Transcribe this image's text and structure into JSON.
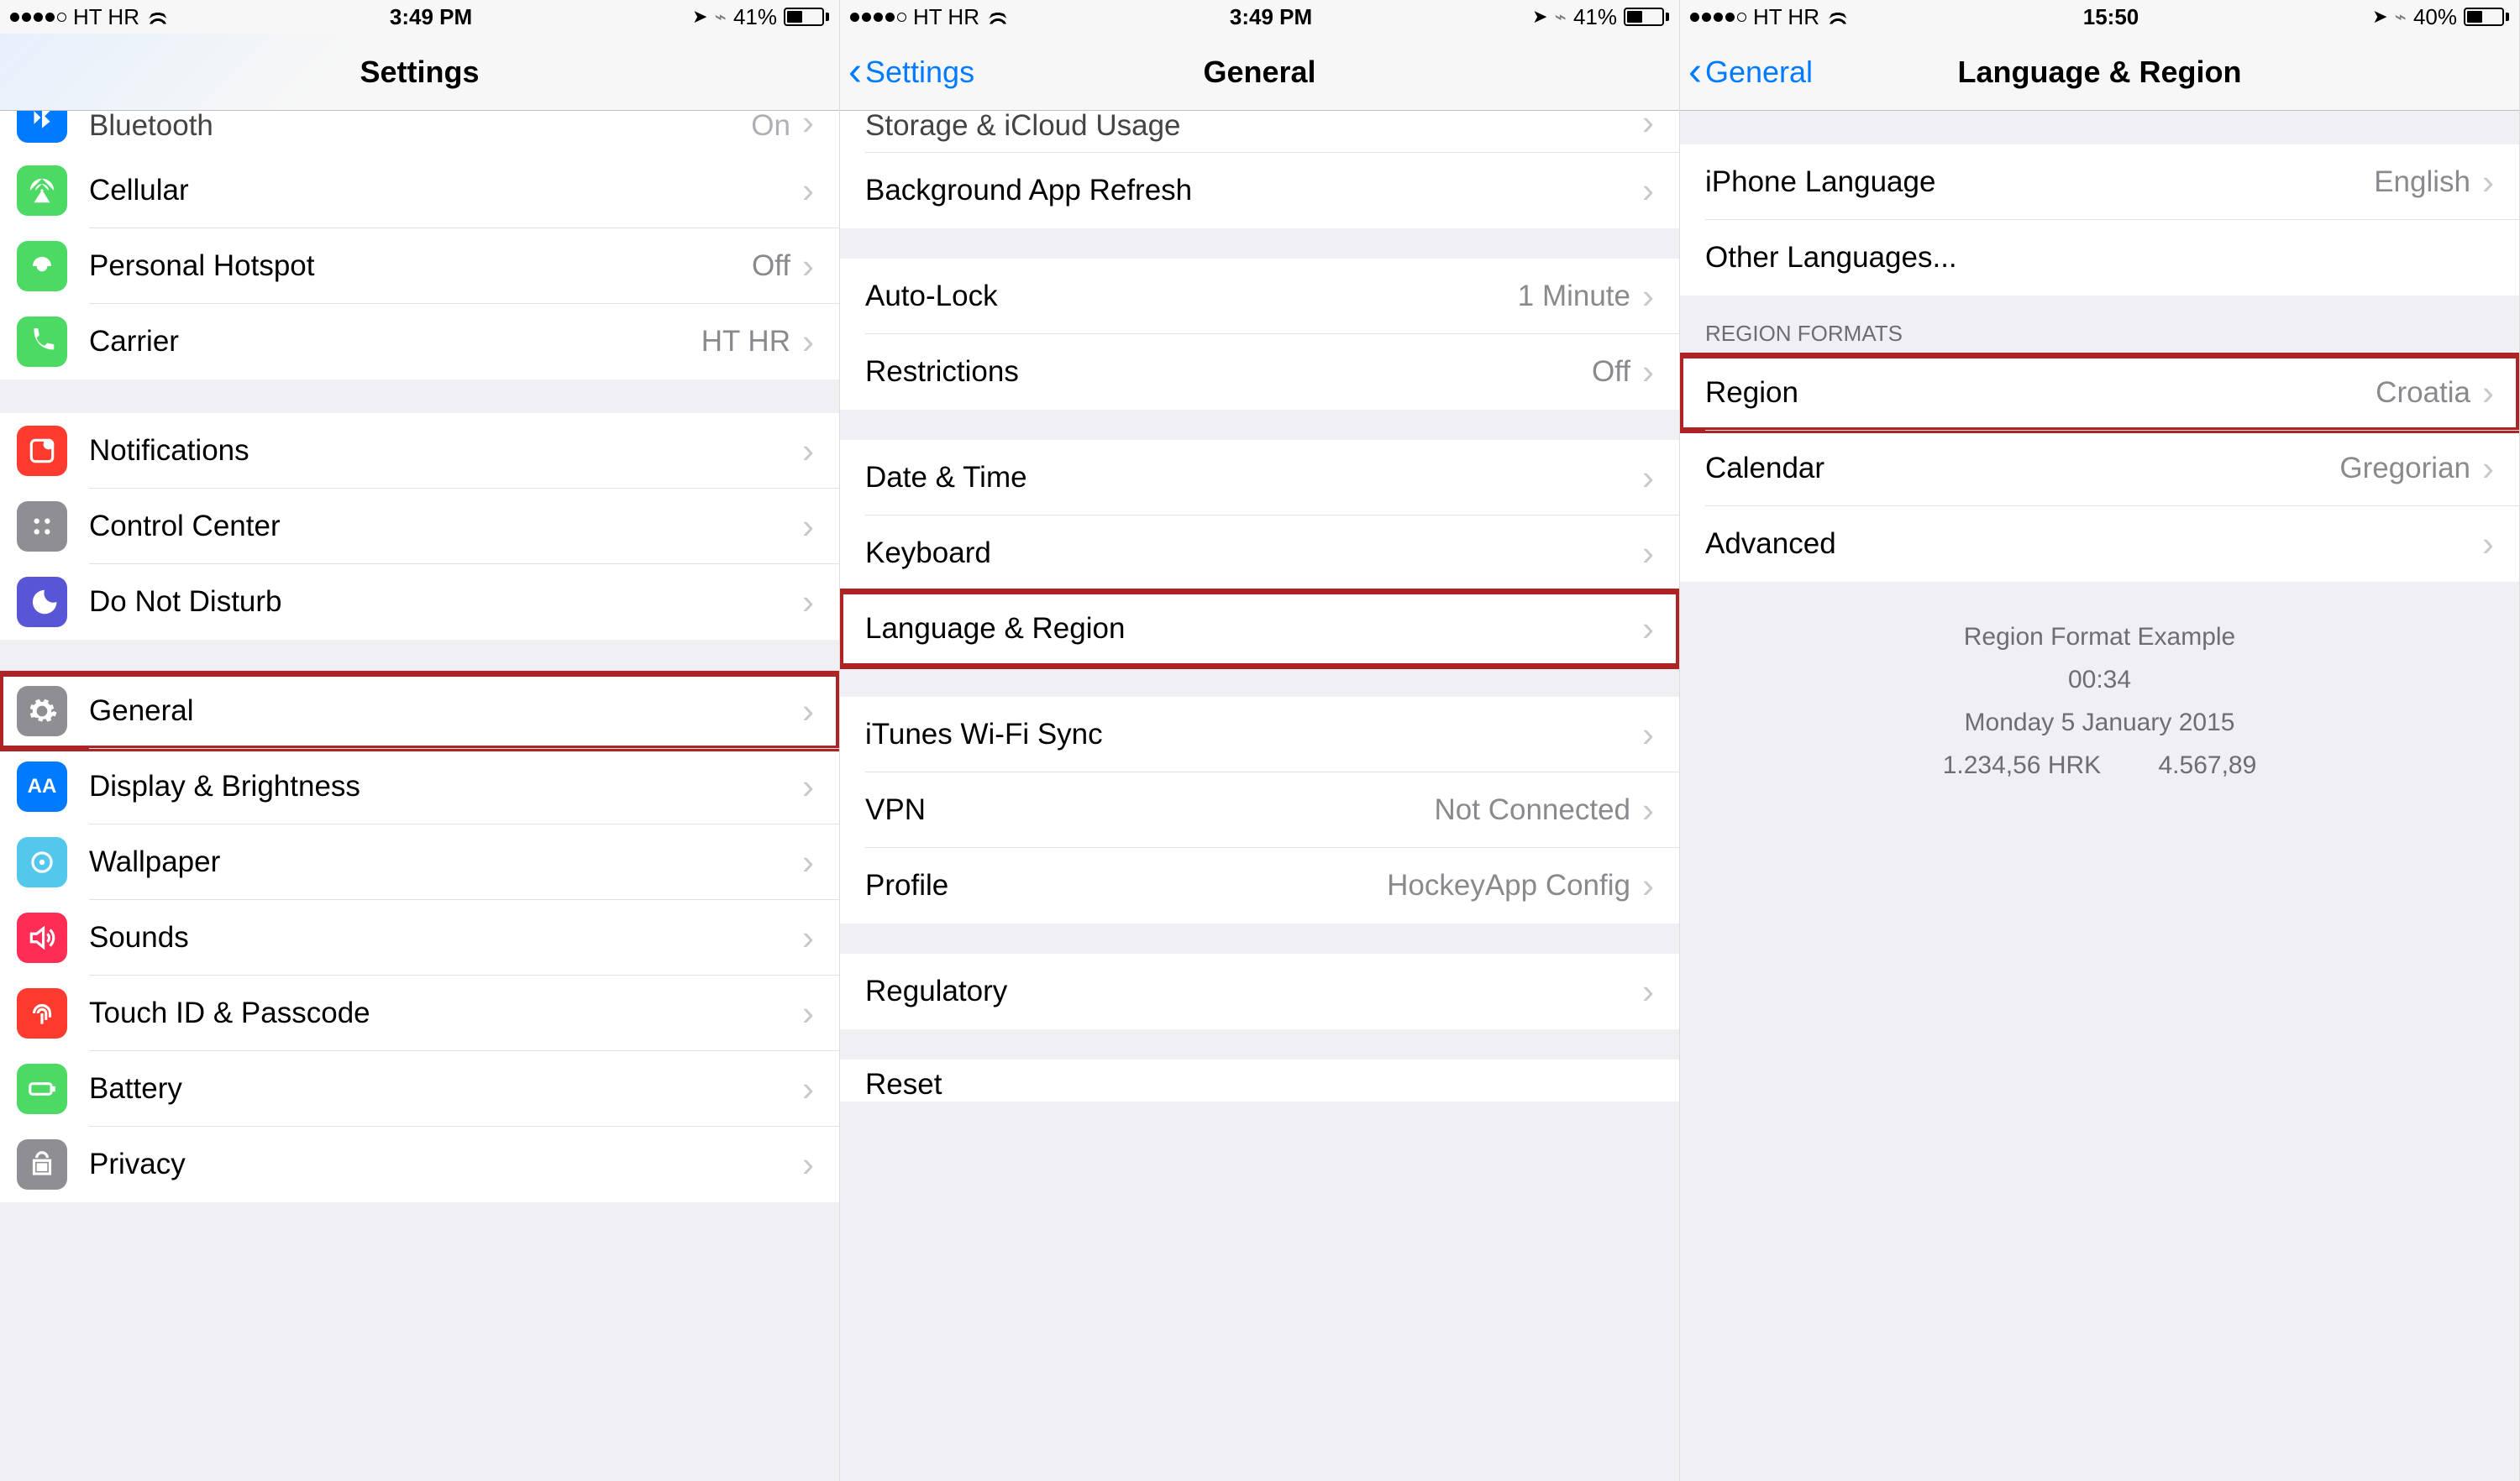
{
  "status": {
    "carrier": "HT HR",
    "time_12h": "3:49 PM",
    "time_24h": "15:50",
    "battery_a": "41%",
    "battery_c": "40%"
  },
  "pane1": {
    "title": "Settings",
    "rows": {
      "bluetooth": {
        "label": "Bluetooth",
        "value": "On"
      },
      "cellular": {
        "label": "Cellular"
      },
      "hotspot": {
        "label": "Personal Hotspot",
        "value": "Off"
      },
      "carrier": {
        "label": "Carrier",
        "value": "HT HR"
      },
      "notifications": {
        "label": "Notifications"
      },
      "control_center": {
        "label": "Control Center"
      },
      "dnd": {
        "label": "Do Not Disturb"
      },
      "general": {
        "label": "General"
      },
      "display": {
        "label": "Display & Brightness"
      },
      "wallpaper": {
        "label": "Wallpaper"
      },
      "sounds": {
        "label": "Sounds"
      },
      "touch_id": {
        "label": "Touch ID & Passcode"
      },
      "battery": {
        "label": "Battery"
      },
      "privacy": {
        "label": "Privacy"
      }
    }
  },
  "pane2": {
    "back": "Settings",
    "title": "General",
    "rows": {
      "storage": {
        "label": "Storage & iCloud Usage"
      },
      "bg_refresh": {
        "label": "Background App Refresh"
      },
      "auto_lock": {
        "label": "Auto-Lock",
        "value": "1 Minute"
      },
      "restrictions": {
        "label": "Restrictions",
        "value": "Off"
      },
      "date_time": {
        "label": "Date & Time"
      },
      "keyboard": {
        "label": "Keyboard"
      },
      "lang_region": {
        "label": "Language & Region"
      },
      "itunes_wifi": {
        "label": "iTunes Wi-Fi Sync"
      },
      "vpn": {
        "label": "VPN",
        "value": "Not Connected"
      },
      "profile": {
        "label": "Profile",
        "value": "HockeyApp Config"
      },
      "regulatory": {
        "label": "Regulatory"
      },
      "reset": {
        "label": "Reset"
      }
    }
  },
  "pane3": {
    "back": "General",
    "title": "Language & Region",
    "rows": {
      "iphone_lang": {
        "label": "iPhone Language",
        "value": "English"
      },
      "other_lang": {
        "label": "Other Languages..."
      },
      "region": {
        "label": "Region",
        "value": "Croatia"
      },
      "calendar": {
        "label": "Calendar",
        "value": "Gregorian"
      },
      "advanced": {
        "label": "Advanced"
      }
    },
    "section_header": "REGION FORMATS",
    "example": {
      "title": "Region Format Example",
      "time": "00:34",
      "date": "Monday 5 January 2015",
      "currency": "1.234,56 HRK",
      "number": "4.567,89"
    }
  }
}
